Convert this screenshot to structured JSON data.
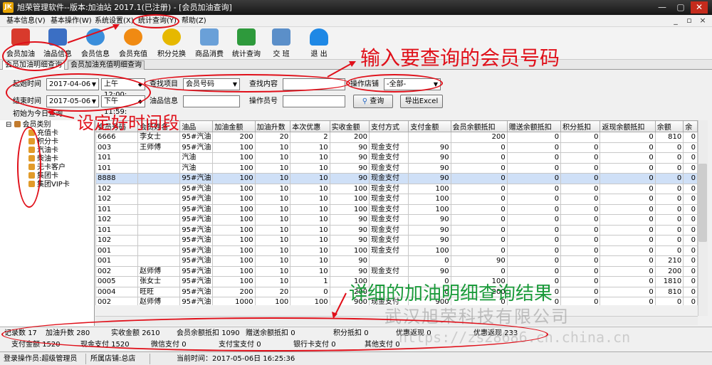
{
  "window": {
    "app_icon": "JK",
    "title": "旭荣管理软件--版本:加油站 2017.1(已注册) - [会员加油查询]",
    "controls": [
      "—",
      "▢",
      "✕"
    ]
  },
  "menu": {
    "items": [
      "基本信息(V)",
      "基本操作(W)",
      "系统设置(X)",
      "统计查询(Y)",
      "帮助(Z)"
    ],
    "mdi_controls": [
      "_",
      "▫",
      "×"
    ]
  },
  "toolbar": {
    "items": [
      {
        "label": "会员加油",
        "icon": "car-icon",
        "color": "#d83a2c"
      },
      {
        "label": "油品信息",
        "icon": "fuel-chart-icon",
        "color": "#3b6fc4"
      },
      {
        "label": "会员信息",
        "icon": "users-icon",
        "color": "#3a8edb"
      },
      {
        "label": "会员充值",
        "icon": "coin-icon",
        "color": "#f08a12"
      },
      {
        "label": "积分兑换",
        "icon": "gift-icon",
        "color": "#e6b800"
      },
      {
        "label": "商品消费",
        "icon": "goods-icon",
        "color": "#6aa0d8"
      },
      {
        "label": "统计查询",
        "icon": "chart-icon",
        "color": "#2e9a3c"
      },
      {
        "label": "交 班",
        "icon": "shift-icon",
        "color": "#5b8fc9"
      },
      {
        "label": "退 出",
        "icon": "exit-icon",
        "color": "#1e88e5"
      }
    ]
  },
  "tabs": [
    {
      "label": "会员加油明细查询",
      "active": true
    },
    {
      "label": "会员加油充值明细查询",
      "active": false
    }
  ],
  "filter": {
    "start_label": "起始时间",
    "start_date": "2017-04-06",
    "start_time": "上午 12:00:",
    "end_label": "结束时间",
    "end_date": "2017-05-06",
    "end_time": "下午 11:59:",
    "search_item_label": "查找项目",
    "search_item_value": "会员号码",
    "search_content_label": "查找内容",
    "search_content_value": "",
    "store_label": "操作店铺",
    "store_value": "-全部-",
    "oil_label": "油品信息",
    "oil_value": "",
    "operator_label": "操作员号",
    "operator_value": "",
    "query_button": "查询",
    "export_button": "导出Excel",
    "init_today": "初始为今日查询"
  },
  "tree": {
    "root": "会员类别",
    "children": [
      "充值卡",
      "积分卡",
      "汽油卡",
      "柴油卡",
      "无卡客户",
      "集团卡",
      "集团VIP卡"
    ]
  },
  "grid": {
    "columns": [
      "会员号码",
      "会员姓名",
      "油品",
      "加油金额",
      "加油升数",
      "本次优惠",
      "实收金额",
      "支付方式",
      "支付金额",
      "会员余额抵扣",
      "赠送余额抵扣",
      "积分抵扣",
      "返现余额抵扣",
      "余额",
      "余"
    ],
    "rows": [
      [
        "6666",
        "李女士",
        "95#汽油",
        "200",
        "20",
        "2",
        "200",
        "",
        "",
        "200",
        "0",
        "0",
        "0",
        "810",
        "0"
      ],
      [
        "003",
        "王师傅",
        "95#汽油",
        "100",
        "10",
        "10",
        "90",
        "现金支付",
        "90",
        "0",
        "0",
        "0",
        "0",
        "0",
        "0"
      ],
      [
        "101",
        "",
        "汽油",
        "100",
        "10",
        "10",
        "90",
        "现金支付",
        "90",
        "0",
        "0",
        "0",
        "0",
        "0",
        "0"
      ],
      [
        "101",
        "",
        "汽油",
        "100",
        "10",
        "10",
        "90",
        "现金支付",
        "90",
        "0",
        "0",
        "0",
        "0",
        "0",
        "0"
      ],
      [
        "8888",
        "",
        "95#汽油",
        "100",
        "10",
        "10",
        "90",
        "现金支付",
        "90",
        "0",
        "0",
        "0",
        "0",
        "0",
        "0"
      ],
      [
        "102",
        "",
        "95#汽油",
        "100",
        "10",
        "10",
        "100",
        "现金支付",
        "100",
        "0",
        "0",
        "0",
        "0",
        "0",
        "0"
      ],
      [
        "102",
        "",
        "95#汽油",
        "100",
        "10",
        "10",
        "100",
        "现金支付",
        "100",
        "0",
        "0",
        "0",
        "0",
        "0",
        "0"
      ],
      [
        "101",
        "",
        "95#汽油",
        "100",
        "10",
        "10",
        "100",
        "现金支付",
        "100",
        "0",
        "0",
        "0",
        "0",
        "0",
        "0"
      ],
      [
        "102",
        "",
        "95#汽油",
        "100",
        "10",
        "10",
        "90",
        "现金支付",
        "90",
        "0",
        "0",
        "0",
        "0",
        "0",
        "0"
      ],
      [
        "101",
        "",
        "95#汽油",
        "100",
        "10",
        "10",
        "90",
        "现金支付",
        "90",
        "0",
        "0",
        "0",
        "0",
        "0",
        "0"
      ],
      [
        "102",
        "",
        "95#汽油",
        "100",
        "10",
        "10",
        "90",
        "现金支付",
        "90",
        "0",
        "0",
        "0",
        "0",
        "0",
        "0"
      ],
      [
        "001",
        "",
        "95#汽油",
        "100",
        "10",
        "10",
        "100",
        "现金支付",
        "100",
        "0",
        "0",
        "0",
        "0",
        "0",
        "0"
      ],
      [
        "001",
        "",
        "95#汽油",
        "100",
        "10",
        "10",
        "90",
        "",
        "0",
        "90",
        "0",
        "0",
        "0",
        "210",
        "0"
      ],
      [
        "002",
        "赵师傅",
        "95#汽油",
        "100",
        "10",
        "10",
        "90",
        "现金支付",
        "90",
        "0",
        "0",
        "0",
        "0",
        "200",
        "0"
      ],
      [
        "0005",
        "张女士",
        "95#汽油",
        "100",
        "10",
        "1",
        "100",
        "",
        "0",
        "100",
        "0",
        "0",
        "0",
        "1810",
        "0"
      ],
      [
        "0004",
        "旺旺",
        "95#汽油",
        "200",
        "20",
        "0",
        "200",
        "",
        "0",
        "200",
        "0",
        "0",
        "0",
        "810",
        "0"
      ],
      [
        "002",
        "赵师傅",
        "95#汽油",
        "1000",
        "100",
        "100",
        "900",
        "现金支付",
        "900",
        "0",
        "0",
        "0",
        "0",
        "0",
        "0"
      ]
    ],
    "selected_row": 4
  },
  "summary": {
    "line1": [
      {
        "label": "记录数",
        "value": "17"
      },
      {
        "label": "加油升数",
        "value": "280"
      },
      {
        "label": "实收金额",
        "value": "2610"
      },
      {
        "label": "会员余额抵扣",
        "value": "1090"
      },
      {
        "label": "赠送余额抵扣",
        "value": "0"
      },
      {
        "label": "积分抵扣",
        "value": "0"
      },
      {
        "label": "优惠返现",
        "value": "0"
      },
      {
        "label": "优惠返现",
        "value": "233"
      }
    ],
    "line2": [
      {
        "label": "支付金额",
        "value": "1520"
      },
      {
        "label": "现金支付",
        "value": "1520"
      },
      {
        "label": "微信支付",
        "value": "0"
      },
      {
        "label": "支付宝支付",
        "value": "0"
      },
      {
        "label": "银行卡支付",
        "value": "0"
      },
      {
        "label": "其他支付",
        "value": "0"
      }
    ]
  },
  "status": {
    "operator": "登录操作员:超级管理员",
    "store": "所属店铺:总店",
    "time": "当前时间：2017-05-06日 16:25:36"
  },
  "annotations": {
    "input_member": "输入要查询的会员号码",
    "set_time": "设定好时间段",
    "result": "详细的加油明细查询结果",
    "color": "#e0101a",
    "result_color": "#1a9a3a"
  },
  "watermark": {
    "company": "武汉旭荣科技有限公司",
    "url": "https://zs28686.cn.china.cn"
  }
}
